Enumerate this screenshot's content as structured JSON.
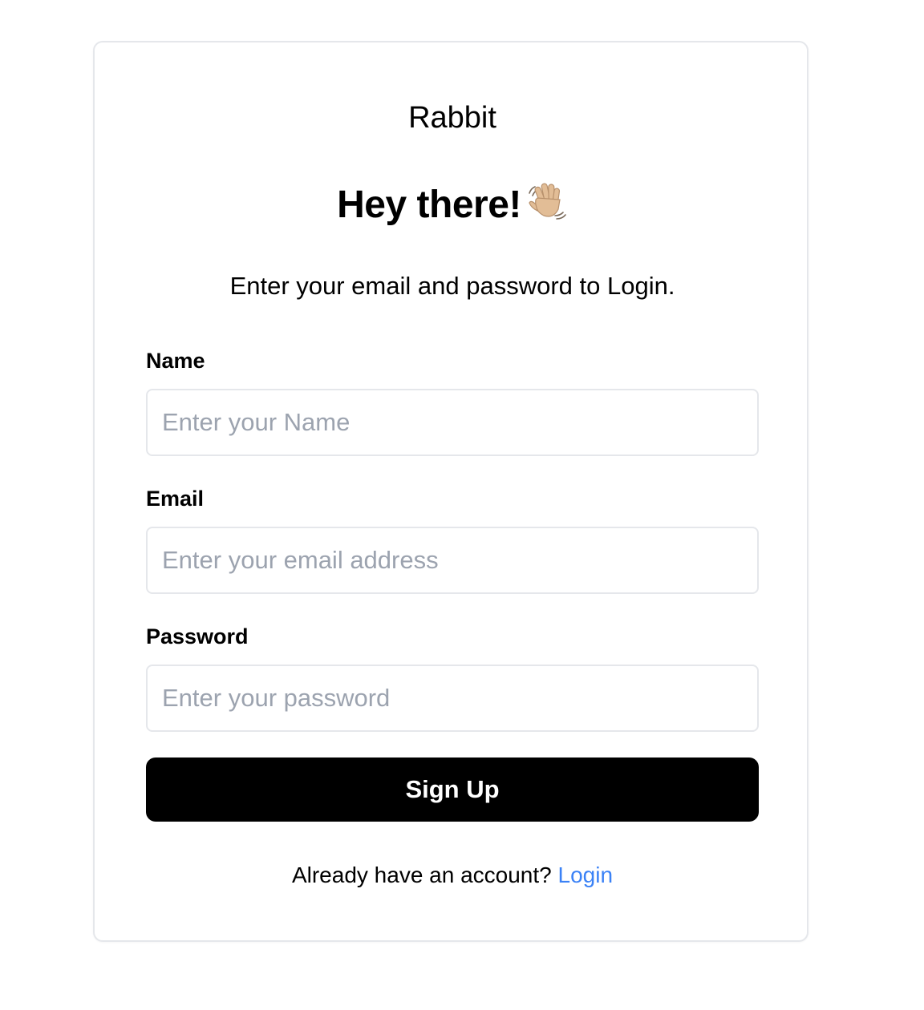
{
  "brand": "Rabbit",
  "greeting": "Hey there!",
  "greeting_icon": "waving-hand-icon",
  "subtitle": "Enter your email and password to Login.",
  "form": {
    "name": {
      "label": "Name",
      "placeholder": "Enter your Name",
      "value": ""
    },
    "email": {
      "label": "Email",
      "placeholder": "Enter your email address",
      "value": ""
    },
    "password": {
      "label": "Password",
      "placeholder": "Enter your password",
      "value": ""
    },
    "submit_label": "Sign Up"
  },
  "footer": {
    "prompt": "Already have an account? ",
    "link_label": "Login"
  },
  "colors": {
    "button_bg": "#000000",
    "link": "#3b82f6",
    "border": "#e5e7eb",
    "placeholder": "#9ca3af"
  }
}
